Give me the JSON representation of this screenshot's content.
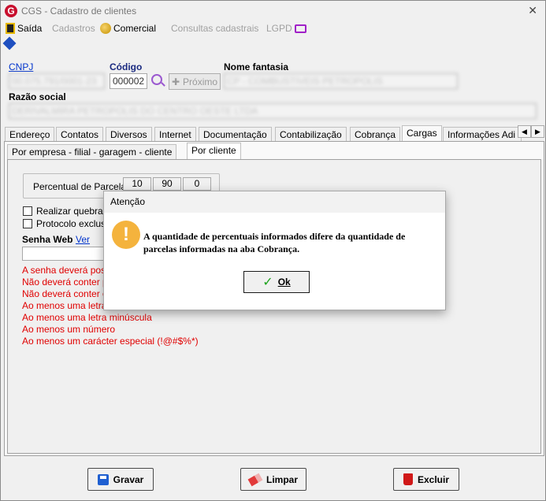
{
  "window": {
    "title": "CGS - Cadastro de clientes",
    "close_glyph": "✕",
    "app_icon_letter": "G"
  },
  "menu": {
    "saida": "Saída",
    "cadastros": "Cadastros",
    "comercial": "Comercial",
    "consultas": "Consultas cadastrais",
    "lgpd": "LGPD"
  },
  "form": {
    "cnpj_label": "CNPJ",
    "cnpj_value": "00.075.791/0001-23",
    "codigo_label": "Código",
    "codigo_value": "000002",
    "proximo_label": "Próximo",
    "nome_fantasia_label": "Nome fantasia",
    "nome_fantasia_value": "CP - COMBUSTIVEIS PETROPOLIS",
    "razao_social_label": "Razão social",
    "razao_social_value": "DERIVALMIRA PETROPOLIS DO CENTRO OESTE LTDA"
  },
  "tabs": [
    "Endereço",
    "Contatos",
    "Diversos",
    "Internet",
    "Documentação",
    "Contabilização",
    "Cobrança",
    "Cargas",
    "Informações Adi"
  ],
  "subtabs": [
    "Por empresa - filial - garagem - cliente",
    "Por cliente"
  ],
  "cargas": {
    "percentual_label": "Percentual de Parcelas",
    "percentuais": [
      "10",
      "90",
      "0"
    ],
    "realizar_quebra": "Realizar quebra da",
    "protocolo_exclusivo": "Protocolo exclusivo",
    "senha_web_label": "Senha Web",
    "ver_link": "Ver",
    "senha_web_value": ""
  },
  "rules": [
    "A senha deverá possu",
    "Não deverá conter pal",
    "Não deverá conter o lo",
    "Ao menos uma letra ma",
    "Ao menos uma letra minúscula",
    "Ao menos um número",
    "Ao menos um carácter especial (!@#$%*)"
  ],
  "buttons": {
    "gravar": "Gravar",
    "limpar": "Limpar",
    "excluir": "Excluir"
  },
  "dialog": {
    "title": "Atenção",
    "icon": "!",
    "message": "A quantidade de percentuais informados difere da quantidade de parcelas informadas na aba Cobrança.",
    "ok": "Ok"
  },
  "colors": {
    "link": "#0033cc",
    "error": "#e00000",
    "warning": "#f4b33d",
    "accent": "#c8102e"
  }
}
